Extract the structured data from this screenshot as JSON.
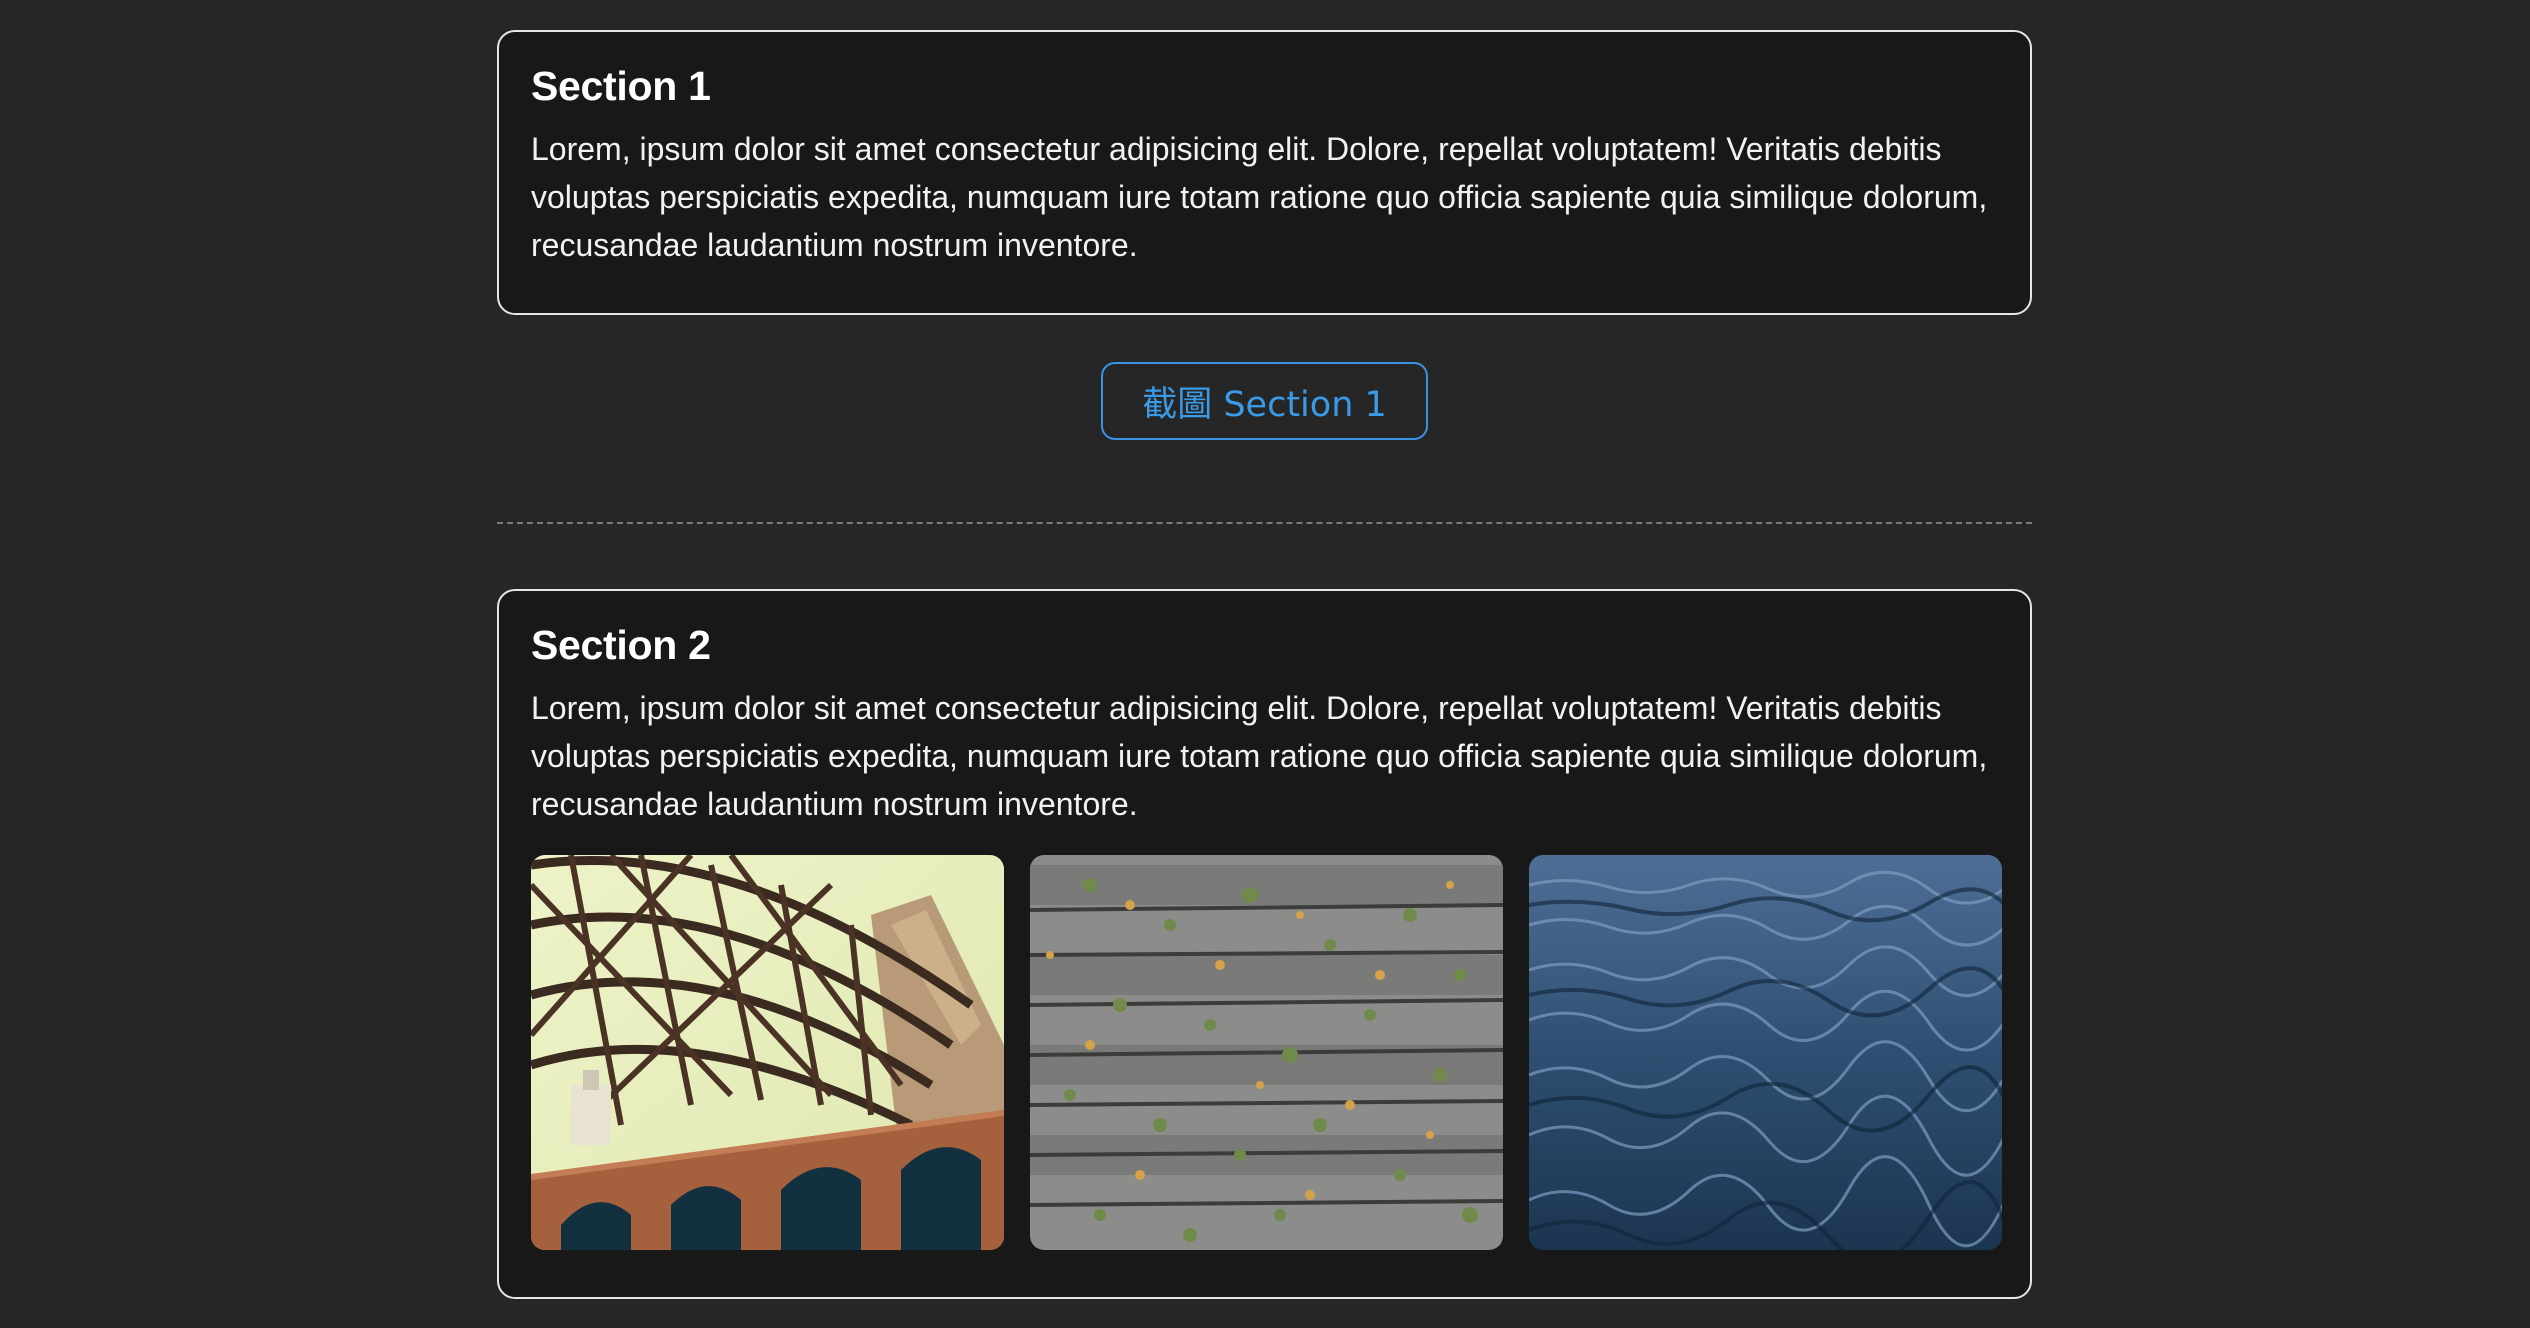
{
  "sections": [
    {
      "title": "Section 1",
      "body": "Lorem, ipsum dolor sit amet consectetur adipisicing elit. Dolore, repellat voluptatem! Veritatis debitis voluptas perspiciatis expedita, numquam iure totam ratione quo officia sapiente quia similique dolorum, recusandae laudantium nostrum inventore."
    },
    {
      "title": "Section 2",
      "body": "Lorem, ipsum dolor sit amet consectetur adipisicing elit. Dolore, repellat voluptatem! Veritatis debitis voluptas perspiciatis expedita, numquam iure totam ratione quo officia sapiente quia similique dolorum, recusandae laudantium nostrum inventore."
    }
  ],
  "capture_button": {
    "label": "截圖 Section 1"
  },
  "images": [
    {
      "subject": "steel-bridge-photo"
    },
    {
      "subject": "wooden-deck-leaves-photo"
    },
    {
      "subject": "ocean-water-photo"
    }
  ],
  "colors": {
    "page_background": "#262626",
    "card_background": "#181818",
    "card_border": "#e6e6e6",
    "accent": "#3a93e6"
  }
}
